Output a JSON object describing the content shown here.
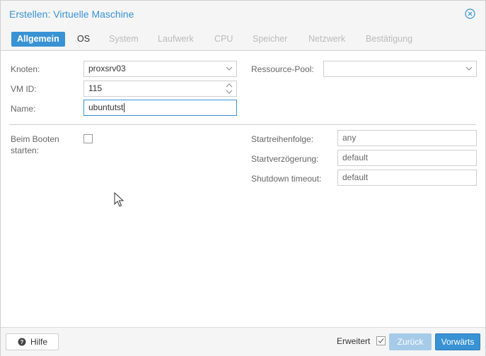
{
  "window": {
    "title": "Erstellen: Virtuelle Maschine"
  },
  "tabs": [
    {
      "label": "Allgemein",
      "state": "active"
    },
    {
      "label": "OS",
      "state": "enabled"
    },
    {
      "label": "System",
      "state": "disabled"
    },
    {
      "label": "Laufwerk",
      "state": "disabled"
    },
    {
      "label": "CPU",
      "state": "disabled"
    },
    {
      "label": "Speicher",
      "state": "disabled"
    },
    {
      "label": "Netzwerk",
      "state": "disabled"
    },
    {
      "label": "Bestätigung",
      "state": "disabled"
    }
  ],
  "form": {
    "node": {
      "label": "Knoten:",
      "value": "proxsrv03"
    },
    "vmid": {
      "label": "VM ID:",
      "value": "115"
    },
    "name": {
      "label": "Name:",
      "value": "ubuntutst"
    },
    "pool": {
      "label": "Ressource-Pool:",
      "value": ""
    },
    "boot": {
      "label_line1": "Beim Booten",
      "label_line2": "starten:",
      "checked": false
    },
    "startorder": {
      "label": "Startreihenfolge:",
      "placeholder": "any"
    },
    "startdelay": {
      "label": "Startverzögerung:",
      "placeholder": "default"
    },
    "shutdown": {
      "label": "Shutdown timeout:",
      "placeholder": "default"
    }
  },
  "footer": {
    "help_label": "Hilfe",
    "advanced_label": "Erweitert",
    "advanced_checked": true,
    "back_label": "Zurück",
    "next_label": "Vorwärts"
  },
  "colors": {
    "accent": "#3892d4",
    "disabled_button": "#a6cbe9"
  }
}
